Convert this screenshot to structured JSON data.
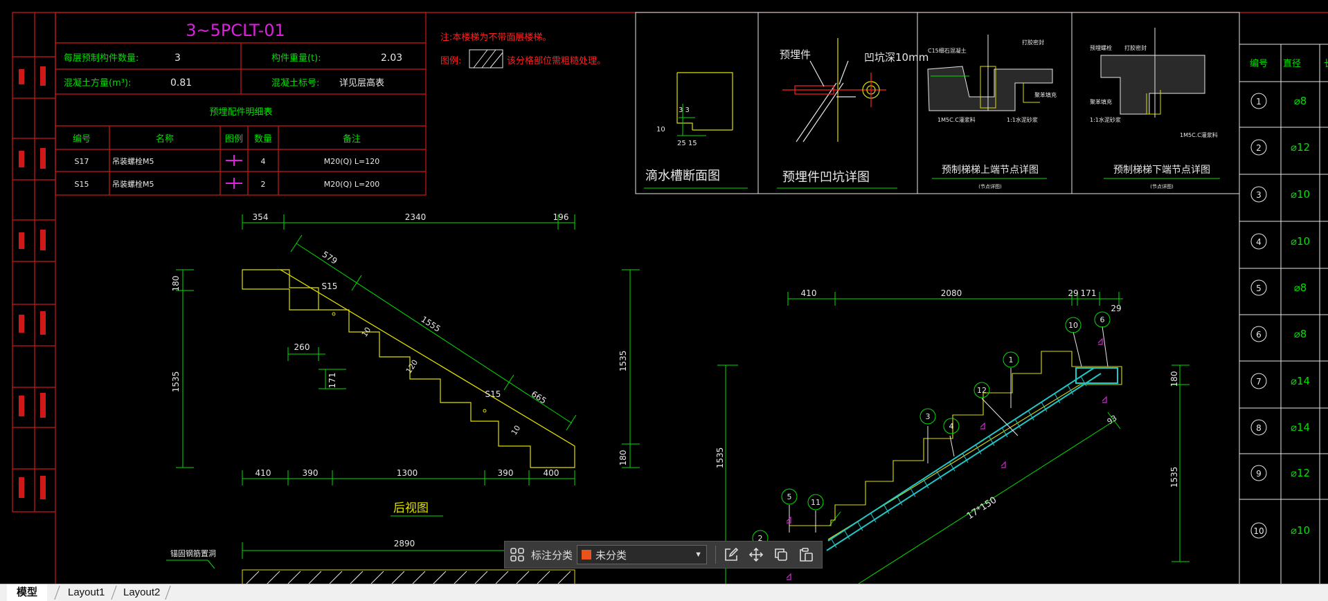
{
  "drawing": {
    "part_title": "3~5PCLT-01",
    "info": {
      "count_label": "每层预制构件数量:",
      "count_value": "3",
      "weight_label": "构件重量(t):",
      "weight_value": "2.03",
      "concrete_volume_label": "混凝土方量(m³):",
      "concrete_volume_value": "0.81",
      "concrete_grade_label": "混凝土标号:",
      "concrete_grade_value": "详见层高表"
    },
    "embedded_table": {
      "title": "预埋配件明细表",
      "headers": [
        "编号",
        "名称",
        "图例",
        "数量",
        "备注"
      ],
      "rows": [
        {
          "id": "S17",
          "name": "吊装螺栓M5",
          "qty": "4",
          "note": "M20(Q) L=120"
        },
        {
          "id": "S15",
          "name": "吊装螺栓M5",
          "qty": "2",
          "note": "M20(Q) L=200"
        }
      ]
    },
    "notes": {
      "note1": "注:本楼梯为不带面层楼梯。",
      "legend_label": "图例:",
      "legend_text": "该分格部位需粗糙处理。"
    },
    "details": [
      {
        "title": "滴水槽断面图",
        "sub": ""
      },
      {
        "title": "预埋件凹坑详图",
        "sub": "",
        "annotation_a": "预埋件",
        "annotation_b": "凹坑深10mm"
      },
      {
        "title": "预制梯梯上端节点详图",
        "sub": "(节点详图)"
      },
      {
        "title": "预制梯梯下端节点详图",
        "sub": "(节点详图)"
      }
    ],
    "rebar_table": {
      "headers": [
        "编号",
        "直径",
        "长度"
      ],
      "rows": [
        {
          "no": "1",
          "dia": "⌀8"
        },
        {
          "no": "2",
          "dia": "⌀12"
        },
        {
          "no": "3",
          "dia": "⌀10"
        },
        {
          "no": "4",
          "dia": "⌀10"
        },
        {
          "no": "5",
          "dia": "⌀8"
        },
        {
          "no": "6",
          "dia": "⌀8"
        },
        {
          "no": "7",
          "dia": "⌀14"
        },
        {
          "no": "8",
          "dia": "⌀14"
        },
        {
          "no": "9",
          "dia": "⌀12"
        },
        {
          "no": "10",
          "dia": "⌀10"
        }
      ]
    },
    "left_view": {
      "top_dims": [
        "354",
        "2340",
        "196"
      ],
      "bottom_dims": [
        "410",
        "390",
        "1300",
        "390",
        "400"
      ],
      "left_dims": [
        "180",
        "1535"
      ],
      "right_dims": [
        "1535",
        "180"
      ],
      "slope_dims": [
        "579",
        "1555",
        "665"
      ],
      "step_w": "260",
      "step_h": "171",
      "tags": [
        "S15",
        "S15",
        "10",
        "10",
        "120"
      ],
      "caption": "后视图"
    },
    "right_view": {
      "top_dims": [
        "410",
        "2080",
        "29",
        "171",
        "29"
      ],
      "left_dim": "1535",
      "right_dims": [
        "1535",
        "180"
      ],
      "slope_text": "17*150",
      "end_dim": "93",
      "markers": [
        "10",
        "6",
        "1",
        "12",
        "3",
        "4",
        "5",
        "11",
        "2"
      ]
    },
    "bottom_view": {
      "dim": "2890",
      "label": "锚固钢筋置洞"
    }
  },
  "toolbar": {
    "label": "标注分类",
    "selected": "未分类",
    "swatch_color": "#e8541c"
  },
  "tabs": [
    {
      "label": "模型",
      "active": true
    },
    {
      "label": "Layout1",
      "active": false
    },
    {
      "label": "Layout2",
      "active": false
    }
  ]
}
